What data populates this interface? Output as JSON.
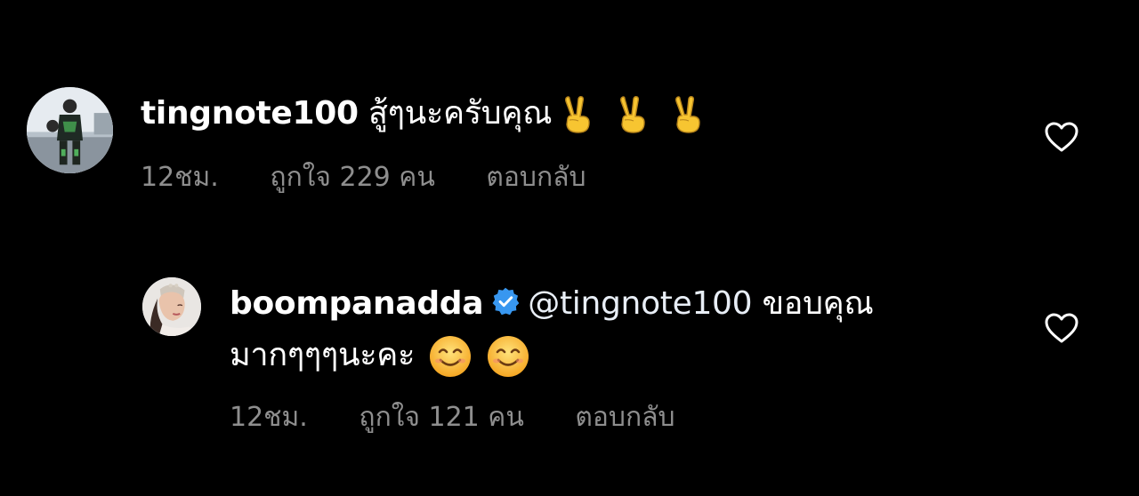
{
  "colors": {
    "background": "#000000",
    "text_primary": "#ffffff",
    "text_secondary": "#8e8e8e",
    "verified_blue": "#3897f0"
  },
  "comments": [
    {
      "username": "tingnote100",
      "text": "สู้ๆนะครับคุณ",
      "emojis": [
        "victory-hand",
        "victory-hand",
        "victory-hand"
      ],
      "time": "12ชม.",
      "likes": "ถูกใจ 229 คน",
      "reply_label": "ตอบกลับ",
      "avatar_icon": "avatar-rider-photo",
      "like_icon": "heart-outline-icon"
    },
    {
      "username": "boompanadda",
      "verified": true,
      "mention": "@tingnote100",
      "text_line1": "ขอบคุณ",
      "text_line2": "มากๆๆๆนะคะ",
      "emojis": [
        "smiling-face",
        "smiling-face"
      ],
      "time": "12ชม.",
      "likes": "ถูกใจ 121 คน",
      "reply_label": "ตอบกลับ",
      "avatar_icon": "avatar-portrait-photo",
      "like_icon": "heart-outline-icon"
    }
  ]
}
